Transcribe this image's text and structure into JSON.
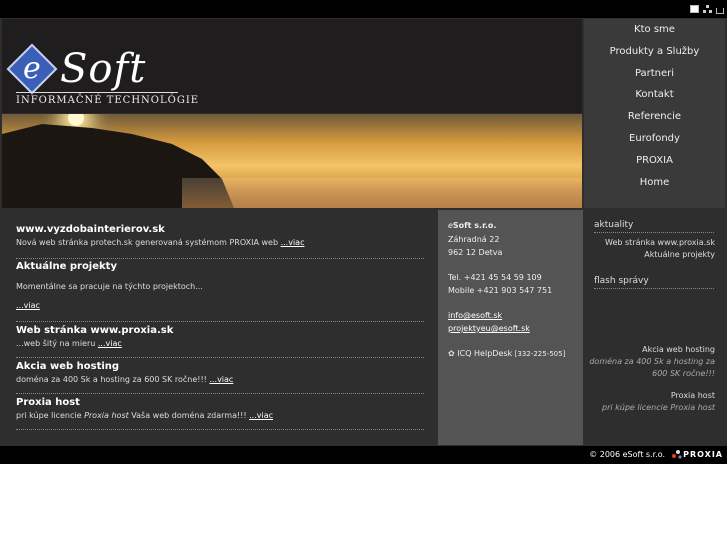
{
  "header": {
    "logo_letter": "e",
    "logo_word": "Soft",
    "logo_sub": "INFORMAČNÉ TECHNOLÓGIE",
    "top_icons": [
      "home-icon",
      "sitemap-icon",
      "print-icon"
    ]
  },
  "nav": {
    "items": [
      {
        "label": "Kto sme"
      },
      {
        "label": "Produkty a Služby"
      },
      {
        "label": "Partneri"
      },
      {
        "label": "Kontakt"
      },
      {
        "label": "Referencie"
      },
      {
        "label": "Eurofondy"
      },
      {
        "label": "PROXIA"
      },
      {
        "label": "Home"
      }
    ]
  },
  "news": [
    {
      "title": "www.vyzdobainterierov.sk",
      "text": "Nová web stránka protech.sk generovaná systémom PROXIA web",
      "more": "...viac"
    },
    {
      "title": "Aktuálne projekty",
      "text": "Momentálne sa pracuje na týchto projektoch...",
      "more": "...viac"
    },
    {
      "title": "Web stránka www.proxia.sk",
      "text": "...web šitý na mieru",
      "more": "...viac"
    },
    {
      "title": "Akcia web hosting",
      "text": "doména za 400 Sk a hosting za 600 SK ročne!!!",
      "more": "...viac"
    },
    {
      "title": "Proxia host",
      "text_pre": "pri kúpe licencie ",
      "text_em": "Proxia host",
      "text_post": " Vaša web doména zdarma!!!",
      "more": "...viac"
    }
  ],
  "contact": {
    "company_prefix": "e",
    "company": "Soft s.r.o.",
    "street": "Záhradná 22",
    "city": "962 12 Detva",
    "tel": "Tel. +421 45 54 59 109",
    "mobile": "Mobile +421 903 547 751",
    "email1": "info@esoft.sk",
    "email2": "projektyeu@esoft.sk",
    "icq_label": "ICQ HelpDesk",
    "icq_number": "[332-225-505]"
  },
  "side": {
    "aktuality_head": "aktuality",
    "aktuality_items": [
      "Web stránka www.proxia.sk",
      "Aktuálne projekty"
    ],
    "flash_head": "flash správy",
    "flash_items": [
      {
        "title": "Akcia web hosting",
        "text": "doména za 400 Sk a hosting za 600 SK ročne!!!"
      },
      {
        "title": "Proxia host",
        "text": "pri kúpe licencie Proxia host"
      }
    ]
  },
  "footer": {
    "copyright": "© 2006 eSoft s.r.o.",
    "proxia": "PROXIA"
  }
}
